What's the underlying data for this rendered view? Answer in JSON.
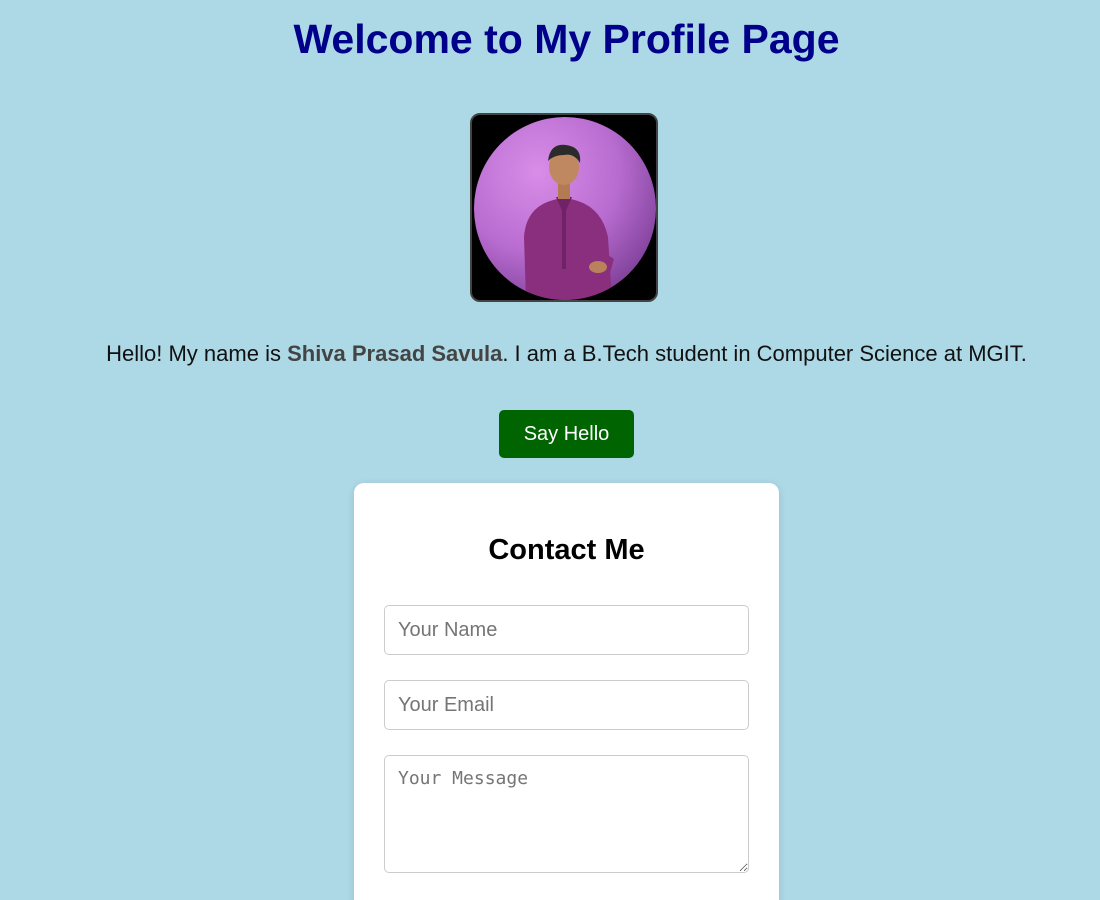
{
  "header": {
    "title": "Welcome to My Profile Page"
  },
  "profile": {
    "photo_description": "profile-photo",
    "intro_prefix": "Hello! My name is ",
    "name": "Shiva Prasad Savula",
    "intro_suffix": ". I am a B.Tech student in Computer Science at MGIT."
  },
  "actions": {
    "say_hello_label": "Say Hello"
  },
  "contact": {
    "title": "Contact Me",
    "name_placeholder": "Your Name",
    "email_placeholder": "Your Email",
    "message_placeholder": "Your Message",
    "name_value": "",
    "email_value": "",
    "message_value": ""
  },
  "colors": {
    "background": "#add8e6",
    "title": "#00008b",
    "button": "#006400",
    "card": "#ffffff"
  }
}
